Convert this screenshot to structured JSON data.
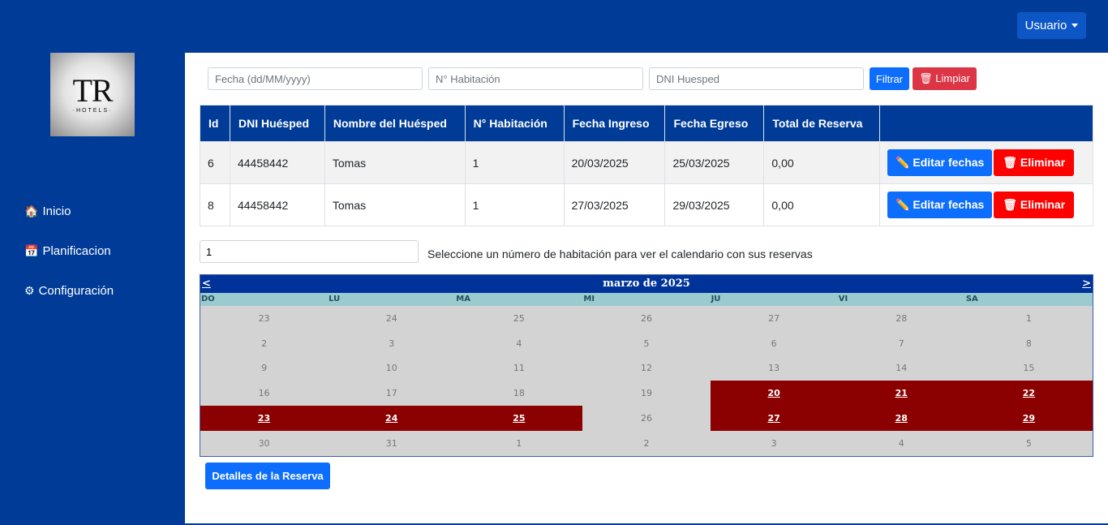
{
  "header": {
    "user_label": "Usuario"
  },
  "sidebar": {
    "logo_text": "TR",
    "logo_sub": "·HOTELS·",
    "items": [
      {
        "icon": "home-icon",
        "glyph": "🏠",
        "label": "Inicio"
      },
      {
        "icon": "calendar-icon",
        "glyph": "📅",
        "label": "Planificacion"
      },
      {
        "icon": "gear-icon",
        "glyph": "⚙",
        "label": "Configuración"
      }
    ]
  },
  "filters": {
    "date_placeholder": "Fecha (dd/MM/yyyy)",
    "room_placeholder": "N° Habitación",
    "dni_placeholder": "DNI Huesped",
    "filter_label": "Filtrar",
    "clear_label": "Limpiar",
    "clear_icon": "trash-icon"
  },
  "table": {
    "headers": [
      "Id",
      "DNI Huésped",
      "Nombre del Huésped",
      "N° Habitación",
      "Fecha Ingreso",
      "Fecha Egreso",
      "Total de Reserva",
      ""
    ],
    "rows": [
      {
        "id": "6",
        "dni": "44458442",
        "name": "Tomas",
        "room": "1",
        "checkin": "20/03/2025",
        "checkout": "25/03/2025",
        "total": "0,00"
      },
      {
        "id": "8",
        "dni": "44458442",
        "name": "Tomas",
        "room": "1",
        "checkin": "27/03/2025",
        "checkout": "29/03/2025",
        "total": "0,00"
      }
    ],
    "edit_label": "Editar fechas",
    "delete_label": "Eliminar"
  },
  "room_selector": {
    "value": "1",
    "hint": "Seleccione un número de habitación para ver el calendario con sus reservas"
  },
  "calendar": {
    "title": "marzo de 2025",
    "prev": "<",
    "next": ">",
    "weekdays": [
      "DO",
      "LU",
      "MA",
      "MI",
      "JU",
      "VI",
      "SA"
    ],
    "booked_color": "#8b0000",
    "weeks": [
      [
        [
          "23",
          false
        ],
        [
          "24",
          false
        ],
        [
          "25",
          false
        ],
        [
          "26",
          false
        ],
        [
          "27",
          false
        ],
        [
          "28",
          false
        ],
        [
          "1",
          false
        ]
      ],
      [
        [
          "2",
          false
        ],
        [
          "3",
          false
        ],
        [
          "4",
          false
        ],
        [
          "5",
          false
        ],
        [
          "6",
          false
        ],
        [
          "7",
          false
        ],
        [
          "8",
          false
        ]
      ],
      [
        [
          "9",
          false
        ],
        [
          "10",
          false
        ],
        [
          "11",
          false
        ],
        [
          "12",
          false
        ],
        [
          "13",
          false
        ],
        [
          "14",
          false
        ],
        [
          "15",
          false
        ]
      ],
      [
        [
          "16",
          false
        ],
        [
          "17",
          false
        ],
        [
          "18",
          false
        ],
        [
          "19",
          false
        ],
        [
          "20",
          true
        ],
        [
          "21",
          true
        ],
        [
          "22",
          true
        ]
      ],
      [
        [
          "23",
          true
        ],
        [
          "24",
          true
        ],
        [
          "25",
          true
        ],
        [
          "26",
          false
        ],
        [
          "27",
          true
        ],
        [
          "28",
          true
        ],
        [
          "29",
          true
        ]
      ],
      [
        [
          "30",
          false
        ],
        [
          "31",
          false
        ],
        [
          "1",
          false
        ],
        [
          "2",
          false
        ],
        [
          "3",
          false
        ],
        [
          "4",
          false
        ],
        [
          "5",
          false
        ]
      ]
    ]
  },
  "details_label": "Detalles de la Reserva"
}
